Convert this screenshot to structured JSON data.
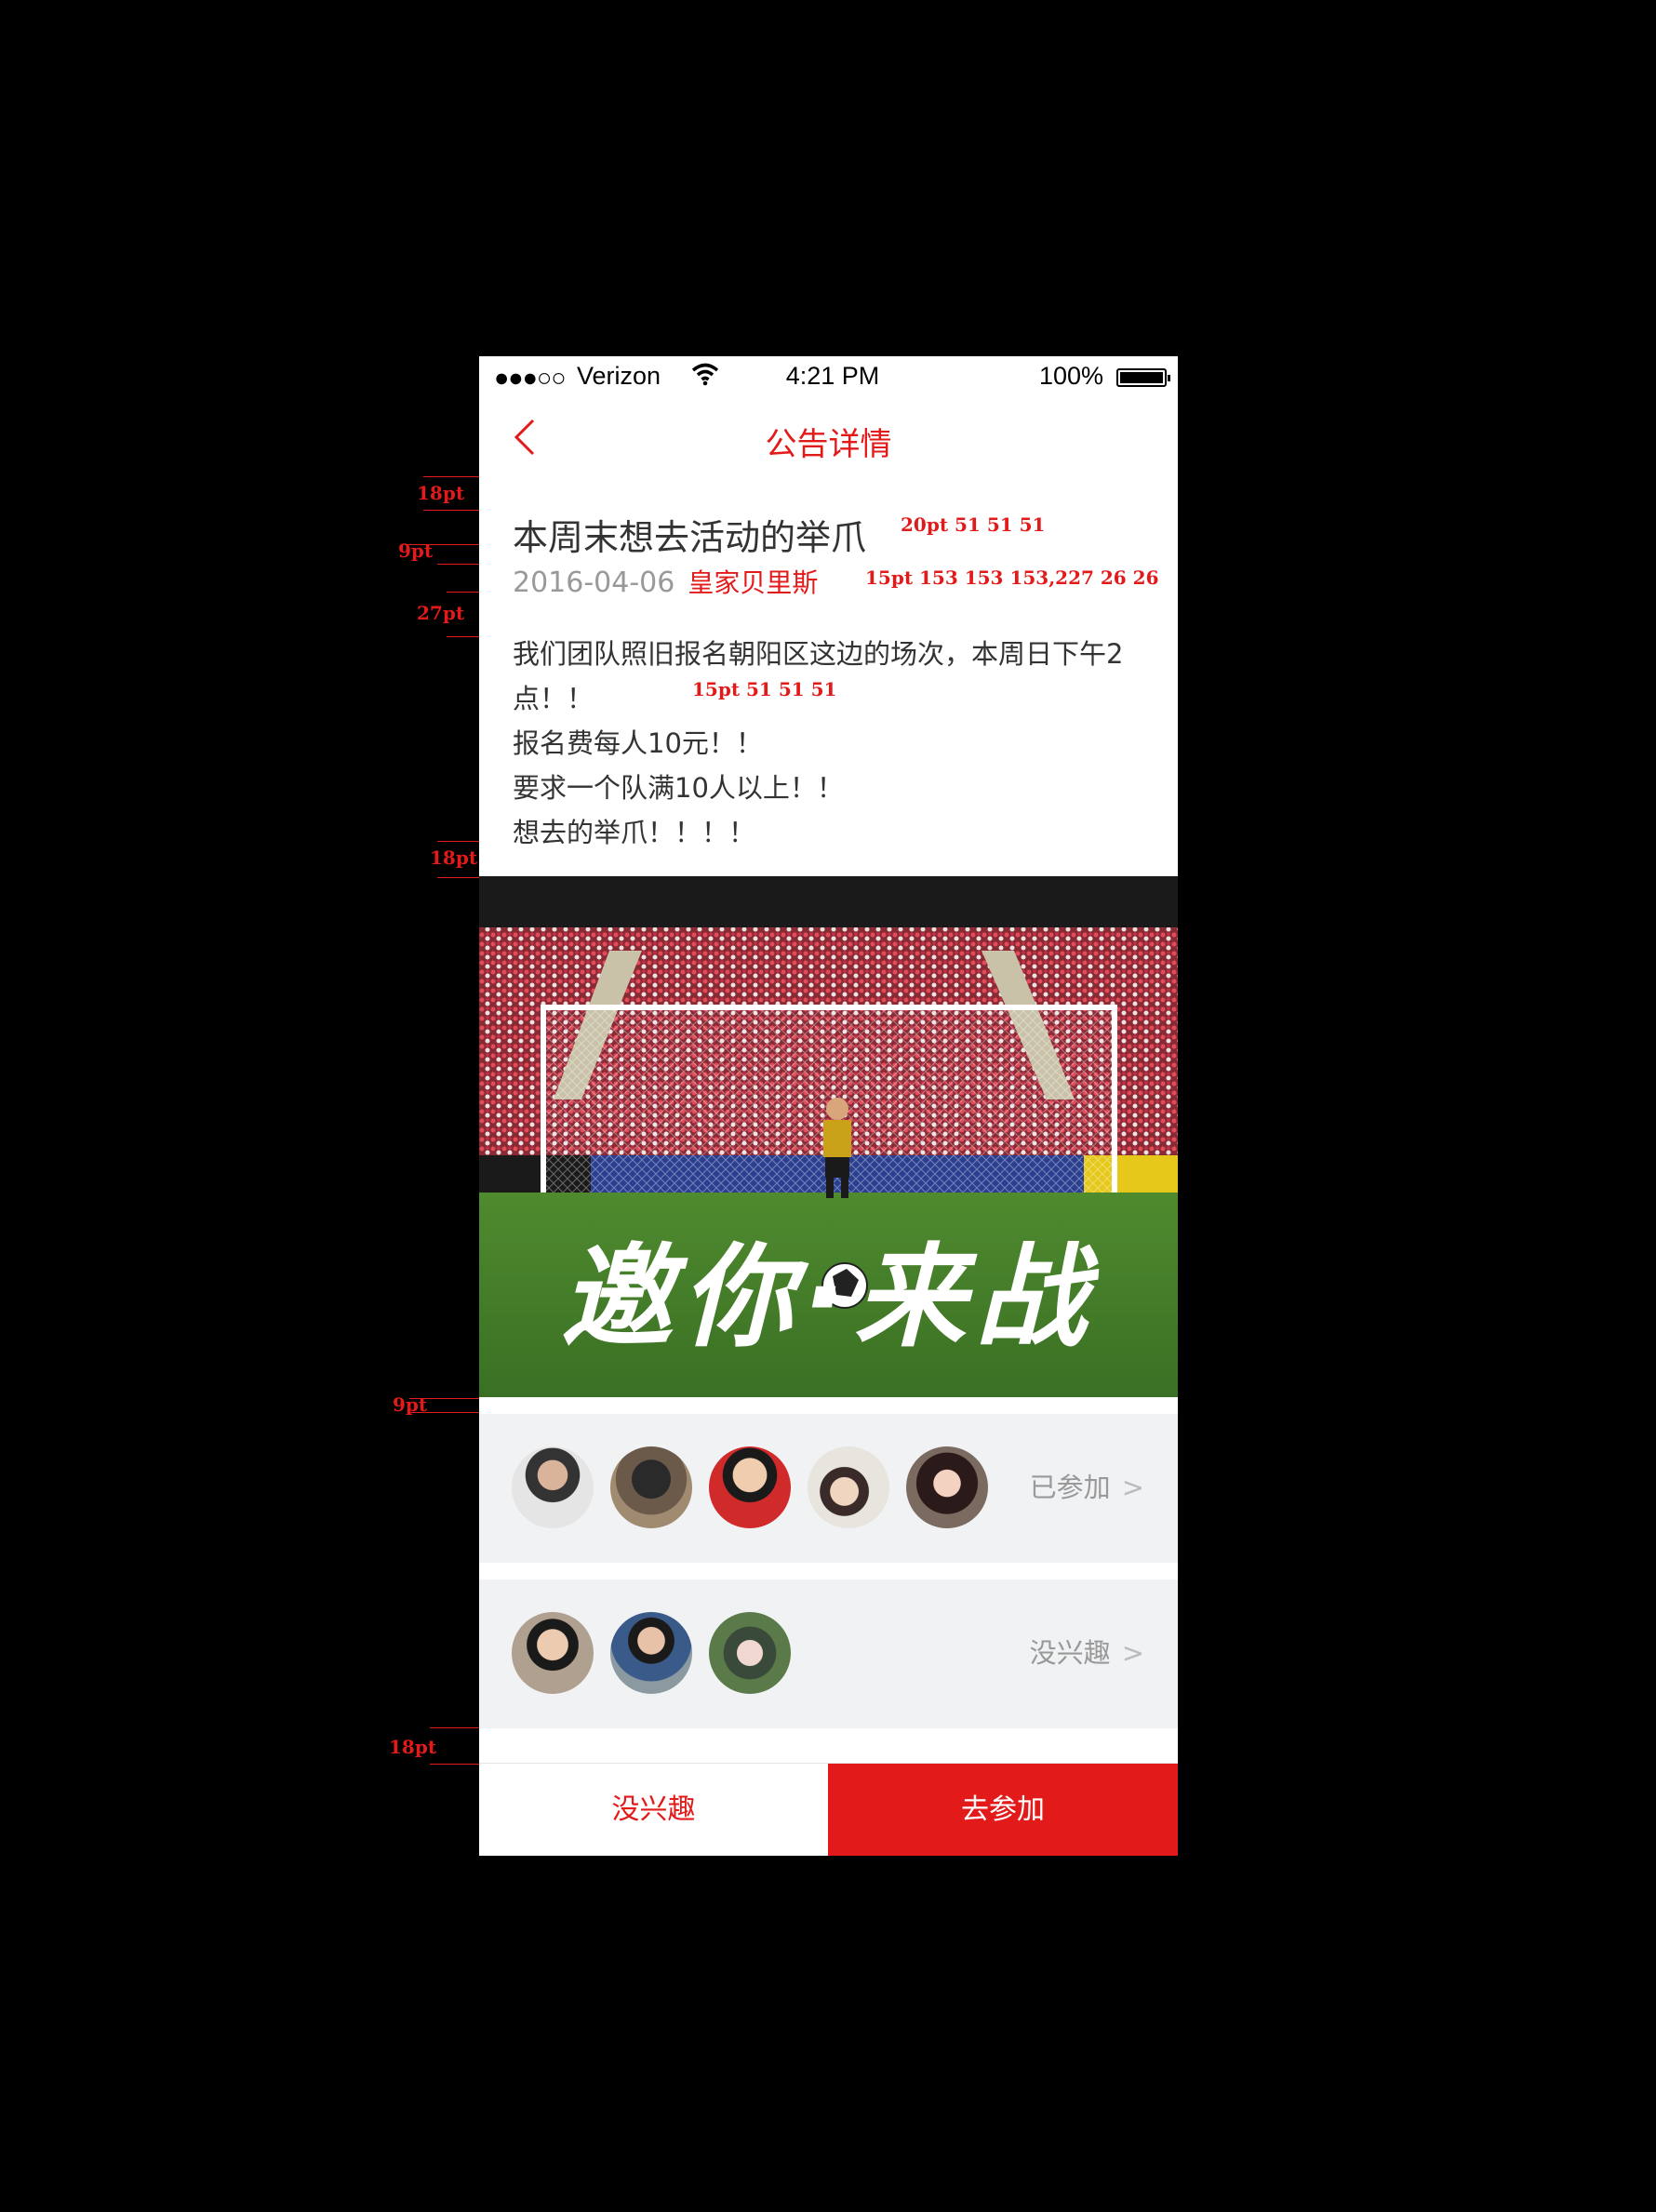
{
  "status_bar": {
    "signal": "●●●○○",
    "carrier": "Verizon",
    "time": "4:21 PM",
    "battery_pct": "100%"
  },
  "nav": {
    "title": "公告详情"
  },
  "post": {
    "title": "本周末想去活动的举爪",
    "date": "2016-04-06",
    "author": "皇家贝里斯",
    "body_lines": [
      "我们团队照旧报名朝阳区这边的场次，本周日下午2",
      "点！！",
      "报名费每人10元！！",
      "要求一个队满10人以上！！",
      "想去的举爪！！！！"
    ]
  },
  "banner": {
    "slogan": "邀你·来战"
  },
  "joined": {
    "label": "已参加",
    "avatar_count": 5
  },
  "no_interest": {
    "label": "没兴趣",
    "avatar_count": 3
  },
  "bottom": {
    "not_interested": "没兴趣",
    "join": "去参加"
  },
  "annotations": {
    "a1": "18pt",
    "a2": "9pt",
    "a3": "27pt",
    "a4": "18pt",
    "a5": "9pt",
    "a6": "18pt",
    "title_spec": "20pt 51 51 51",
    "meta_spec": "15pt 153 153 153,227 26 26",
    "body_spec": "15pt 51 51 51"
  },
  "colors": {
    "accent": "#e31a1a",
    "text": "#333333",
    "muted": "#999999",
    "row_bg": "#f1f2f4"
  }
}
